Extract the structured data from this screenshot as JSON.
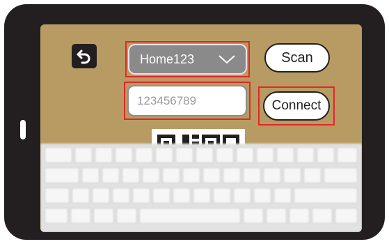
{
  "screen": {
    "network_select": {
      "value": "Home123"
    },
    "password_input": {
      "value": "123456789"
    },
    "scan_label": "Scan",
    "connect_label": "Connect"
  },
  "icons": {
    "back": "undo-arrow-icon",
    "dropdown": "chevron-down-icon",
    "qr": "qr-code-icon",
    "keyboard": "on-screen-keyboard"
  },
  "colors": {
    "device": "#231f20",
    "screen": "#b89b62",
    "highlight": "#e0262b",
    "select_bg": "#8a8a8a"
  }
}
